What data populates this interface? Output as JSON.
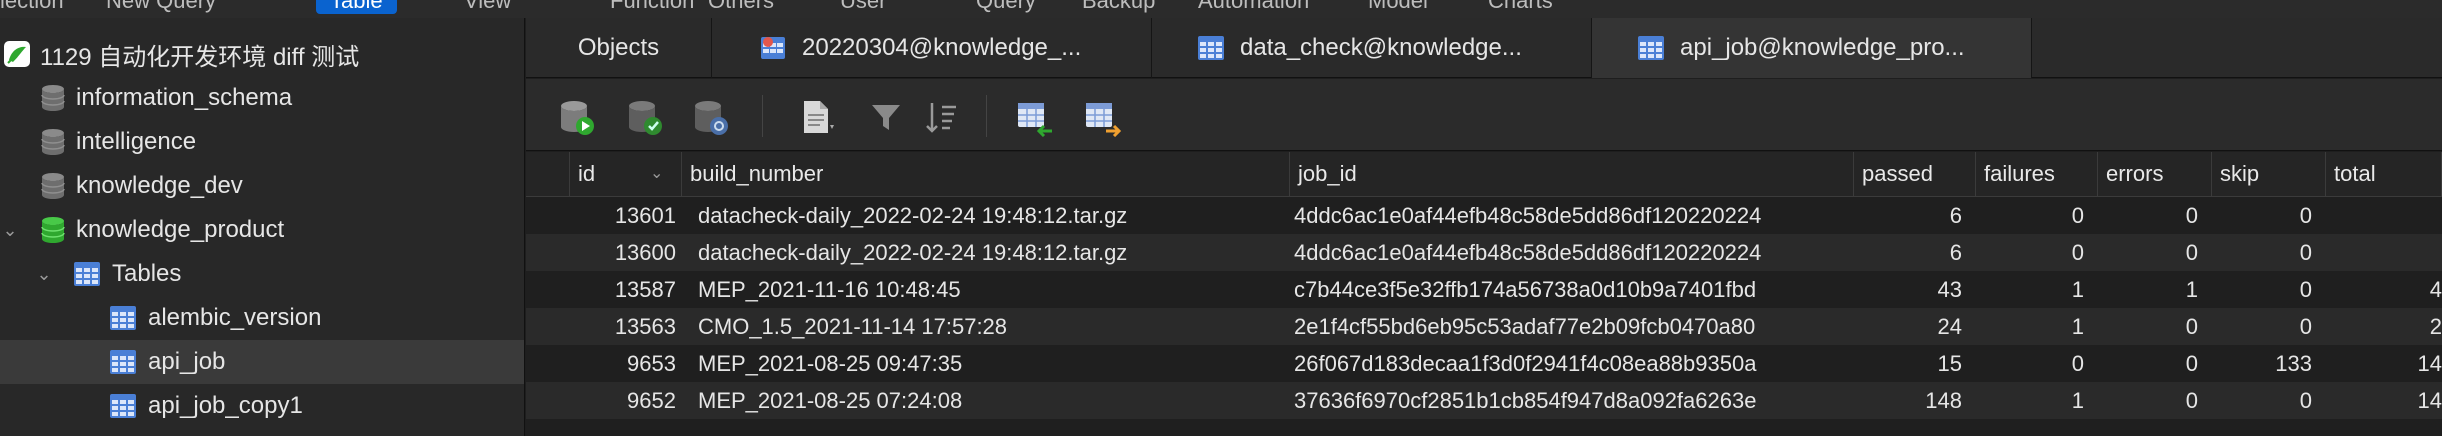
{
  "menu": [
    "lection",
    "New Query",
    "Table",
    "View",
    "Function",
    "Others",
    "User",
    "Query",
    "Backup",
    "Automation",
    "Model",
    "Charts"
  ],
  "sidebar": {
    "connection": "1129 自动化开发环境 diff 测试",
    "databases": [
      "information_schema",
      "intelligence",
      "knowledge_dev",
      "knowledge_product"
    ],
    "tables_label": "Tables",
    "tables": [
      "alembic_version",
      "api_job",
      "api_job_copy1"
    ]
  },
  "tabs": [
    {
      "label": "Objects"
    },
    {
      "label": "20220304@knowledge_..."
    },
    {
      "label": "data_check@knowledge..."
    },
    {
      "label": "api_job@knowledge_pro..."
    }
  ],
  "toolbar": {
    "icons": [
      "new-query-icon",
      "run-icon",
      "stop-icon",
      "document-icon",
      "filter-icon",
      "sort-icon",
      "import-icon",
      "export-icon"
    ]
  },
  "grid": {
    "columns": [
      "id",
      "build_number",
      "job_id",
      "passed",
      "failures",
      "errors",
      "skip",
      "total"
    ],
    "rows": [
      [
        "13601",
        "datacheck-daily_2022-02-24 19:48:12.tar.gz",
        "4ddc6ac1e0af44efb48c58de5dd86df120220224",
        "6",
        "0",
        "0",
        "0",
        ""
      ],
      [
        "13600",
        "datacheck-daily_2022-02-24 19:48:12.tar.gz",
        "4ddc6ac1e0af44efb48c58de5dd86df120220224",
        "6",
        "0",
        "0",
        "0",
        ""
      ],
      [
        "13587",
        "MEP_2021-11-16 10:48:45",
        "c7b44ce3f5e32ffb174a56738a0d10b9a7401fbd",
        "43",
        "1",
        "1",
        "0",
        "4"
      ],
      [
        "13563",
        "CMO_1.5_2021-11-14 17:57:28",
        "2e1f4cf55bd6eb95c53adaf77e2b09fcb0470a80",
        "24",
        "1",
        "0",
        "0",
        "2"
      ],
      [
        "9653",
        "MEP_2021-08-25 09:47:35",
        "26f067d183decaa1f3d0f2941f4c08ea88b9350a",
        "15",
        "0",
        "0",
        "133",
        "14"
      ],
      [
        "9652",
        "MEP_2021-08-25 07:24:08",
        "37636f6970cf2851b1cb854f947d8a092fa6263e",
        "148",
        "1",
        "0",
        "0",
        "14"
      ]
    ]
  },
  "colors": {
    "db_icon": "#7a7a7a",
    "db_active": "#2fa82f",
    "table_icon": "#4a7fd6",
    "accent": "#0a63cf"
  }
}
